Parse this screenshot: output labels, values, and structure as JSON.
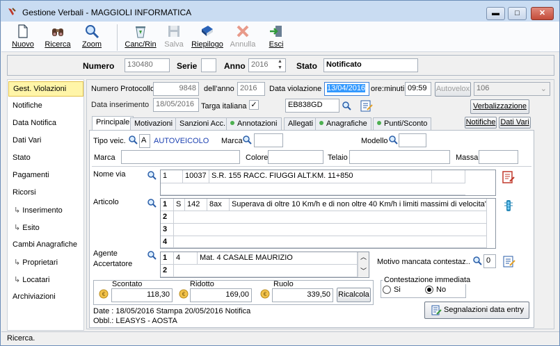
{
  "window": {
    "title": "Gestione Verbali - MAGGIOLI INFORMATICA",
    "min": "▬",
    "max": "□",
    "close": "✕"
  },
  "toolbar": {
    "nuovo": "Nuovo",
    "ricerca": "Ricerca",
    "zoom": "Zoom",
    "canc": "Canc/Rin",
    "salva": "Salva",
    "riepilogo": "Riepilogo",
    "annulla": "Annulla",
    "esci": "Esci"
  },
  "record": {
    "numero_label": "Numero",
    "numero": "130480",
    "serie_label": "Serie",
    "serie": "",
    "anno_label": "Anno",
    "anno": "2016",
    "stato_label": "Stato",
    "stato": "Notificato"
  },
  "nav": [
    "Gest. Violazioni",
    "Notifiche",
    "Data Notifica",
    "Dati Vari",
    "Stato",
    "Pagamenti",
    "Ricorsi",
    "Inserimento",
    "Esito",
    "Cambi Anagrafiche",
    "Proprietari",
    "Locatari",
    "Archiviazioni"
  ],
  "header": {
    "protocollo_label": "Numero Protocollo",
    "protocollo": "9848",
    "anno_label": "dell'anno",
    "anno": "2016",
    "data_viol_label": "Data violazione",
    "data_viol": "13/04/2016",
    "ore_label": "ore:minuti",
    "ore": "09:59",
    "autovelox": "Autovelox",
    "autovelox_val": "106",
    "data_ins_label": "Data inserimento",
    "data_ins": "18/05/2016",
    "targa_label": "Targa italiana",
    "targa": "EB838GD",
    "verbalizzazione": "Verbalizzazione"
  },
  "tabs": [
    "Principale",
    "Motivazioni",
    "Sanzioni Acc.",
    "Annotazioni",
    "Allegati",
    "Anagrafiche",
    "Punti/Sconto"
  ],
  "tab_buttons": {
    "notifiche": "Notifiche",
    "dati_vari": "Dati Vari"
  },
  "veicolo": {
    "tipo_label": "Tipo veic.",
    "tipo_code": "A",
    "tipo_desc": "AUTOVEICOLO",
    "marca_label": "Marca",
    "modello_label": "Modello",
    "marca2_label": "Marca",
    "colore_label": "Colore",
    "telaio_label": "Telaio",
    "massa_label": "Massa"
  },
  "nome_via": {
    "label": "Nome via",
    "rows": [
      [
        "1",
        "10037",
        "S.R. 155 RACC. FIUGGI ALT.KM. 11+850"
      ]
    ]
  },
  "articolo": {
    "label": "Articolo",
    "rows": [
      [
        "1",
        "S",
        "142",
        "8ax",
        "Superava di oltre 10 Km/h e di non oltre 40 Km/h i limiti massimi di velocita'..."
      ],
      [
        "2",
        "",
        "",
        "",
        ""
      ],
      [
        "3",
        "",
        "",
        "",
        ""
      ],
      [
        "4",
        "",
        "",
        "",
        ""
      ]
    ]
  },
  "agente": {
    "label1": "Agente",
    "label2": "Accertatore",
    "rows": [
      [
        "1",
        "4",
        "Mat. 4 CASALE MAURIZIO"
      ],
      [
        "2",
        "",
        ""
      ]
    ]
  },
  "motivo": {
    "label": "Motivo mancata contestaz..",
    "value": "0"
  },
  "importi": {
    "scontato_label": "Scontato",
    "scontato": "118,30",
    "ridotto_label": "Ridotto",
    "ridotto": "169,00",
    "ruolo_label": "Ruolo",
    "ruolo": "339,50",
    "ricalcola": "Ricalcola"
  },
  "contestazione": {
    "label": "Contestazione immediata",
    "si": "Si",
    "no": "No"
  },
  "info": {
    "line1": "Date : 18/05/2016 Stampa   20/05/2016 Notifica",
    "line2": "Obbl.: LEASYS - AOSTA"
  },
  "segnalazioni": "Segnalazioni data entry",
  "status": "Ricerca."
}
